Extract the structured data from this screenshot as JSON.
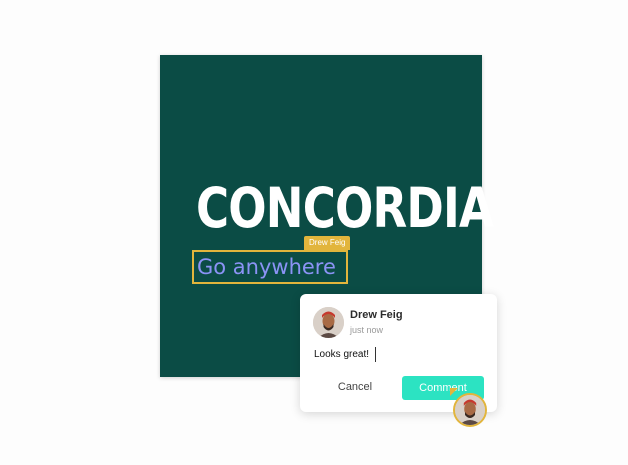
{
  "design": {
    "logo_text": "CONCORDIA",
    "selected_text": "Go anywhere",
    "collaborator_tag": "Drew Feig"
  },
  "comment": {
    "author": "Drew Feig",
    "time": "just now",
    "text": "Looks great!",
    "cancel_label": "Cancel",
    "submit_label": "Comment"
  },
  "colors": {
    "card_background": "#0b4c45",
    "selection_accent": "#e2b53c",
    "selected_text": "#8b93f5",
    "comment_button": "#2ce3c2"
  },
  "icons": {
    "comment_avatar": "user-avatar-icon",
    "cursor_avatar": "collaborator-cursor-avatar-icon",
    "pointer": "cursor-pointer-icon"
  }
}
